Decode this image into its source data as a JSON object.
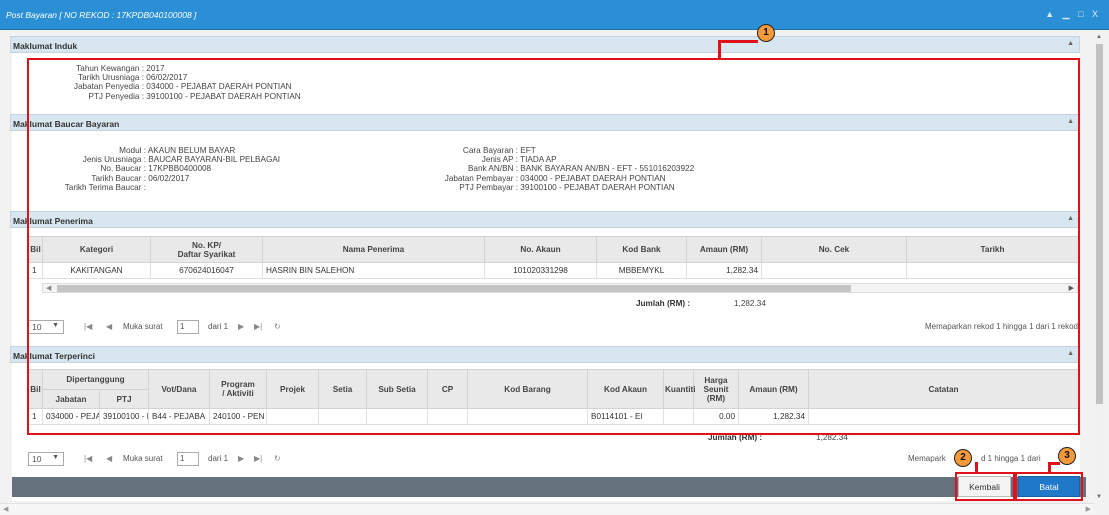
{
  "window": {
    "title": "Post Bayaran [ NO REKOD : 17KPDB040100008 ]",
    "controls": "▲ ▁ □ X"
  },
  "sections": {
    "induk": "Maklumat Induk",
    "baucar": "Maklumat Baucar Bayaran",
    "penerima": "Maklumat Penerima",
    "terperinci": "Maklumat Terperinci"
  },
  "induk": [
    {
      "label": "Tahun Kewangan :",
      "value": "2017"
    },
    {
      "label": "Tarikh Urusniaga :",
      "value": "06/02/2017"
    },
    {
      "label": "Jabatan Penyedia :",
      "value": "034000 - PEJABAT DAERAH PONTIAN"
    },
    {
      "label": "PTJ Penyedia :",
      "value": "39100100 - PEJABAT DAERAH PONTIAN"
    }
  ],
  "baucar_left": [
    {
      "label": "Modul :",
      "value": "AKAUN BELUM BAYAR"
    },
    {
      "label": "Jenis Urusniaga :",
      "value": "BAUCAR BAYARAN-BIL PELBAGAI"
    },
    {
      "label": "No. Baucar :",
      "value": "17KPBB0400008"
    },
    {
      "label": "Tarikh Baucar :",
      "value": "06/02/2017"
    },
    {
      "label": "Tarikh Terima Baucar :",
      "value": ""
    }
  ],
  "baucar_right": [
    {
      "label": "Cara Bayaran :",
      "value": "EFT"
    },
    {
      "label": "Jenis AP :",
      "value": "TIADA AP"
    },
    {
      "label": "Bank AN/BN :",
      "value": "BANK BAYARAN AN/BN - EFT - 551016203922"
    },
    {
      "label": "Jabatan Pembayar :",
      "value": "034000 - PEJABAT DAERAH PONTIAN"
    },
    {
      "label": "PTJ Pembayar :",
      "value": "39100100 - PEJABAT DAERAH PONTIAN"
    }
  ],
  "penerima": {
    "headers": [
      "Bil",
      "Kategori",
      "No. KP/\nDaftar Syarikat",
      "Nama Penerima",
      "No. Akaun",
      "Kod Bank",
      "Amaun (RM)",
      "No. Cek",
      "Tarikh"
    ],
    "rows": [
      [
        "1",
        "KAKITANGAN",
        "670624016047",
        "HASRIN BIN SALEHON",
        "101020331298",
        "MBBEMYKL",
        "1,282.34",
        "",
        ""
      ]
    ],
    "jumlah_label": "Jumlah (RM) :",
    "jumlah_value": "1,282.34"
  },
  "terperinci": {
    "headers_top": [
      "Bil",
      "Dipertanggung",
      "Vot/Dana",
      "Program\n/ Aktiviti",
      "Projek",
      "Setia",
      "Sub Setia",
      "CP",
      "Kod Barang",
      "Kod Akaun",
      "Kuantiti",
      "Harga\nSeunit\n(RM)",
      "Amaun (RM)",
      "Catatan"
    ],
    "headers_sub": [
      "Jabatan",
      "PTJ"
    ],
    "rows": [
      [
        "1",
        "034000 - PEJA",
        "39100100 - PE",
        "B44 - PEJABA",
        "240100 - PEN",
        "",
        "",
        "",
        "",
        "",
        "B0114101 - El",
        "",
        "0.00",
        "1,282.34",
        ""
      ]
    ],
    "jumlah_label": "Jumlah (RM) :",
    "jumlah_value": "1,282.34"
  },
  "pager": {
    "page_size": "10",
    "muka_surat": "Muka surat",
    "page": "1",
    "dari": "dari 1"
  },
  "pager1_info": "Memaparkan rekod 1 hingga 1 dari 1 rekod",
  "pager2_info_a": "Memapark",
  "pager2_info_b": "d 1 hingga 1 dari",
  "buttons": {
    "kembali": "Kembali",
    "batal": "Batal"
  },
  "callouts": [
    "1",
    "2",
    "3"
  ],
  "colors": {
    "titlebar": "#2b8fd6",
    "section_header": "#d8e6f0",
    "footer": "#65727d",
    "batal": "#1f79c8",
    "callout_red": "#e0111b",
    "callout_orange": "#f59a3a"
  }
}
